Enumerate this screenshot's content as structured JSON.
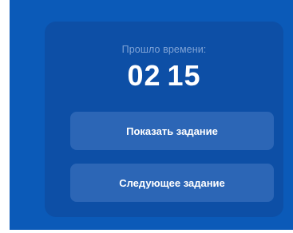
{
  "timer_widget": {
    "elapsed_label": "Прошло времени:",
    "minutes": "02",
    "seconds": "15"
  },
  "actions": {
    "show_task_label": "Показать задание",
    "next_task_label": "Следующее задание"
  },
  "colors": {
    "background": "#0b5ab8",
    "panel": "#0d4fa6",
    "button": "#2c66b6",
    "label_text": "#7fa3d6",
    "text": "#ffffff"
  }
}
